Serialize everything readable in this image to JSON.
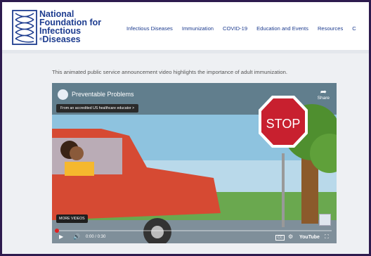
{
  "logo": {
    "lines": [
      "National",
      "Foundation for",
      "Infectious",
      "Diseases"
    ],
    "registered": "®"
  },
  "nav": {
    "items": [
      "Infectious Diseases",
      "Immunization",
      "COVID-19",
      "Education and Events",
      "Resources",
      "C"
    ]
  },
  "intro_text": "This animated public service announcement video highlights the importance of adult immunization.",
  "video": {
    "title": "Preventable Problems",
    "share_label": "Share",
    "badge": "From an accredited US healthcare educator",
    "badge_arrow": ">",
    "more_videos": "MORE VIDEOS",
    "sign_text": "STOP",
    "time": "0:00 / 0:30",
    "cc_label": "CC",
    "youtube_label": "YouTube",
    "progress_fraction": 0.0
  },
  "colors": {
    "brand": "#1d3c8f",
    "frame": "#2d1b4e",
    "page_bg": "#eef0f3",
    "stop_red": "#c8202f",
    "car_red": "#d64a33"
  },
  "icons": [
    "logo-helix-icon",
    "share-icon",
    "play-icon",
    "volume-icon",
    "settings-icon",
    "fullscreen-icon",
    "cc-icon"
  ]
}
